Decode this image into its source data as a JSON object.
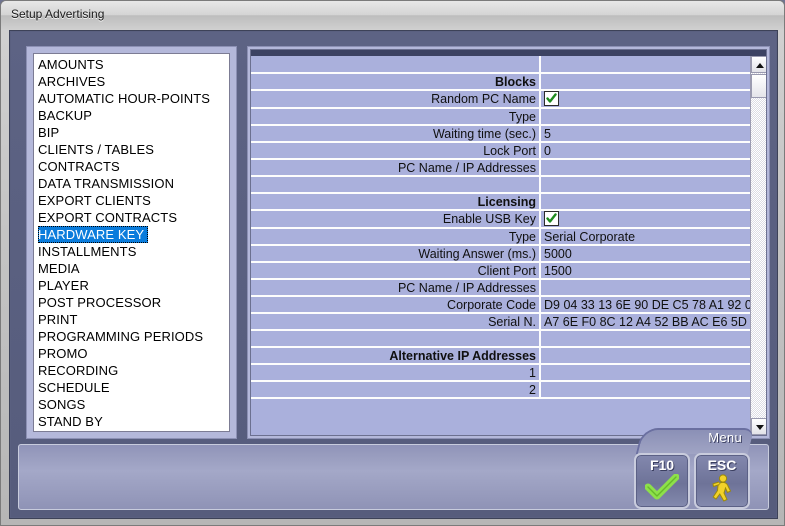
{
  "window": {
    "title": "Setup Advertising"
  },
  "sidebar": {
    "items": [
      {
        "label": "AMOUNTS",
        "selected": false
      },
      {
        "label": "ARCHIVES",
        "selected": false
      },
      {
        "label": "AUTOMATIC HOUR-POINTS",
        "selected": false
      },
      {
        "label": "BACKUP",
        "selected": false
      },
      {
        "label": "BIP",
        "selected": false
      },
      {
        "label": "CLIENTS / TABLES",
        "selected": false
      },
      {
        "label": "CONTRACTS",
        "selected": false
      },
      {
        "label": "DATA TRANSMISSION",
        "selected": false
      },
      {
        "label": "EXPORT CLIENTS",
        "selected": false
      },
      {
        "label": "EXPORT CONTRACTS",
        "selected": false
      },
      {
        "label": "HARDWARE KEY",
        "selected": true
      },
      {
        "label": "INSTALLMENTS",
        "selected": false
      },
      {
        "label": "MEDIA",
        "selected": false
      },
      {
        "label": "PLAYER",
        "selected": false
      },
      {
        "label": "POST PROCESSOR",
        "selected": false
      },
      {
        "label": "PRINT",
        "selected": false
      },
      {
        "label": "PROGRAMMING PERIODS",
        "selected": false
      },
      {
        "label": "PROMO",
        "selected": false
      },
      {
        "label": "RECORDING",
        "selected": false
      },
      {
        "label": "SCHEDULE",
        "selected": false
      },
      {
        "label": "SONGS",
        "selected": false
      },
      {
        "label": "STAND BY",
        "selected": false
      }
    ]
  },
  "grid": {
    "rows": [
      {
        "label": "",
        "value": "",
        "kind": "blank"
      },
      {
        "label": "Blocks",
        "value": "",
        "kind": "section"
      },
      {
        "label": "Random PC Name",
        "value": "",
        "kind": "checkbox",
        "checked": true
      },
      {
        "label": "Type",
        "value": "",
        "kind": "text"
      },
      {
        "label": "Waiting time (sec.)",
        "value": "5",
        "kind": "text"
      },
      {
        "label": "Lock Port",
        "value": "0",
        "kind": "disabled"
      },
      {
        "label": "PC Name / IP Addresses",
        "value": "",
        "kind": "disabled"
      },
      {
        "label": "",
        "value": "",
        "kind": "blank"
      },
      {
        "label": "Licensing",
        "value": "",
        "kind": "section"
      },
      {
        "label": "Enable USB Key",
        "value": "",
        "kind": "checkbox",
        "checked": true
      },
      {
        "label": "Type",
        "value": "Serial Corporate",
        "kind": "text"
      },
      {
        "label": "Waiting Answer (ms.)",
        "value": "5000",
        "kind": "disabled"
      },
      {
        "label": "Client Port",
        "value": "1500",
        "kind": "disabled"
      },
      {
        "label": "PC Name / IP Addresses",
        "value": "",
        "kind": "disabled"
      },
      {
        "label": "Corporate Code",
        "value": "D9 04 33 13 6E 90 DE C5 78 A1 92 0",
        "kind": "text"
      },
      {
        "label": "Serial N.",
        "value": "A7 6E F0 8C 12 A4 52 BB AC E6 5D",
        "kind": "text"
      },
      {
        "label": "",
        "value": "",
        "kind": "blank"
      },
      {
        "label": "Alternative IP Addresses",
        "value": "",
        "kind": "section"
      },
      {
        "label": "1",
        "value": "",
        "kind": "text"
      },
      {
        "label": "2",
        "value": "",
        "kind": "text"
      }
    ]
  },
  "footer": {
    "menu_label": "Menu",
    "ok_key": "F10",
    "esc_key": "ESC"
  }
}
